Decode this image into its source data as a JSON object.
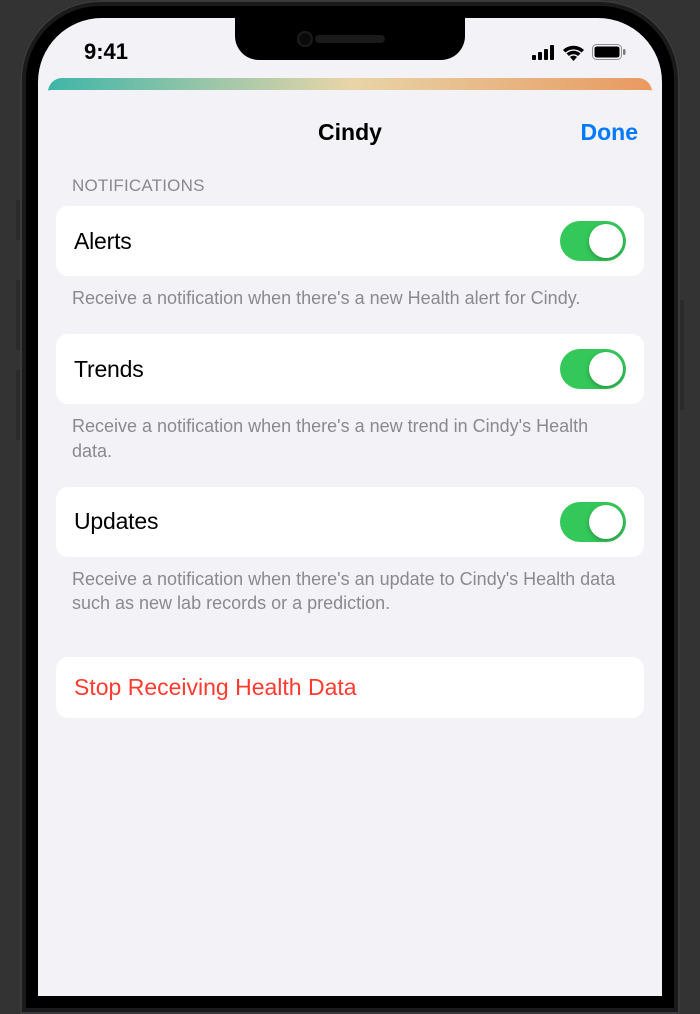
{
  "statusBar": {
    "time": "9:41"
  },
  "sheet": {
    "title": "Cindy",
    "doneLabel": "Done",
    "sectionHeader": "NOTIFICATIONS",
    "rows": [
      {
        "label": "Alerts",
        "footer": "Receive a notification when there's a new Health alert for Cindy.",
        "enabled": true
      },
      {
        "label": "Trends",
        "footer": "Receive a notification when there's a new trend in Cindy's Health data.",
        "enabled": true
      },
      {
        "label": "Updates",
        "footer": "Receive a notification when there's an update to Cindy's Health data such as new lab records or a prediction.",
        "enabled": true
      }
    ],
    "destructiveAction": "Stop Receiving Health Data"
  }
}
